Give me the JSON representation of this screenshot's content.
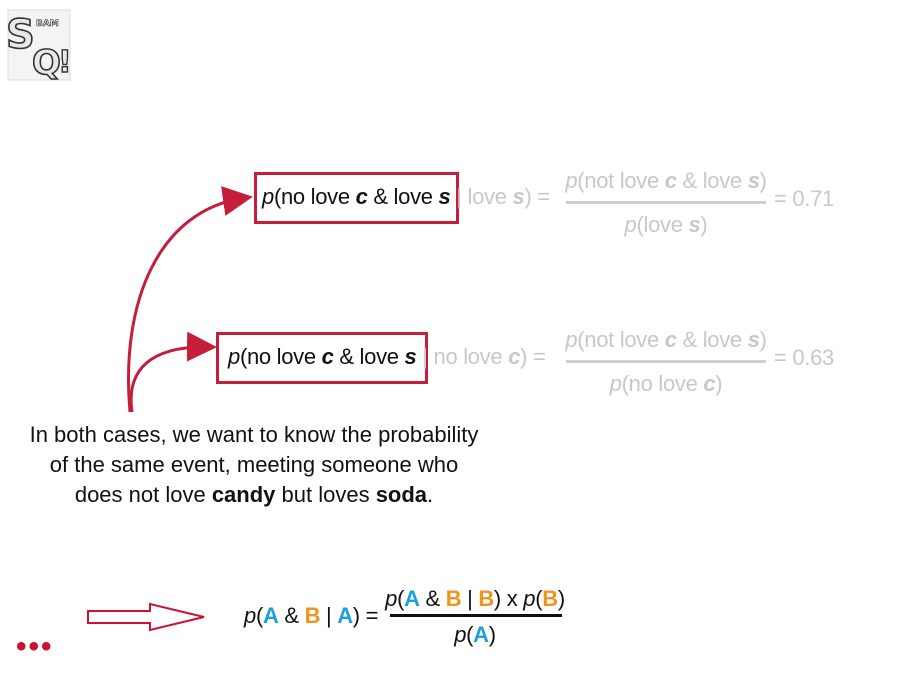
{
  "logo": {
    "text": "StatQuest",
    "icon": "statquest-logo-icon"
  },
  "eq1": {
    "boxed": [
      "p",
      "(no love ",
      "c",
      " & love ",
      "s"
    ],
    "faded_tail": [
      "| love ",
      "s",
      ") ="
    ],
    "numerator": [
      "p",
      "(not love ",
      "c",
      " & love ",
      "s",
      ")"
    ],
    "denominator": [
      "p",
      "(love ",
      "s",
      ")"
    ],
    "result": "= 0.71"
  },
  "eq2": {
    "boxed": [
      "p",
      "(no love ",
      "c",
      " & love ",
      "s"
    ],
    "faded_tail": [
      "| no love ",
      "c",
      ") ="
    ],
    "numerator": [
      "p",
      "(not love ",
      "c",
      " & love ",
      "s",
      ")"
    ],
    "denominator": [
      "p",
      "(no love ",
      "c",
      ")"
    ],
    "result": "= 0.63"
  },
  "caption": {
    "line1": "In both cases, we want to know the probability",
    "line2": "of the same event, meeting someone who",
    "line3_a": "does not love ",
    "line3_b": "candy",
    "line3_c": " but loves ",
    "line3_d": "soda",
    "line3_e": "."
  },
  "bayes": {
    "lhs": [
      "p",
      "(",
      "A",
      " & ",
      "B",
      " | ",
      "A",
      ") ="
    ],
    "numerator": [
      "p",
      "(",
      "A",
      " & ",
      "B",
      " | ",
      "B",
      ") x ",
      "p",
      "(",
      "B",
      ")"
    ],
    "denominator": [
      "p",
      "(",
      "A",
      ")"
    ]
  },
  "ellipsis": "•••",
  "colors": {
    "accent_red": "#c41e3a",
    "blue": "#1a9fe0",
    "orange": "#f0941e",
    "faded": "#c8c8c8"
  }
}
